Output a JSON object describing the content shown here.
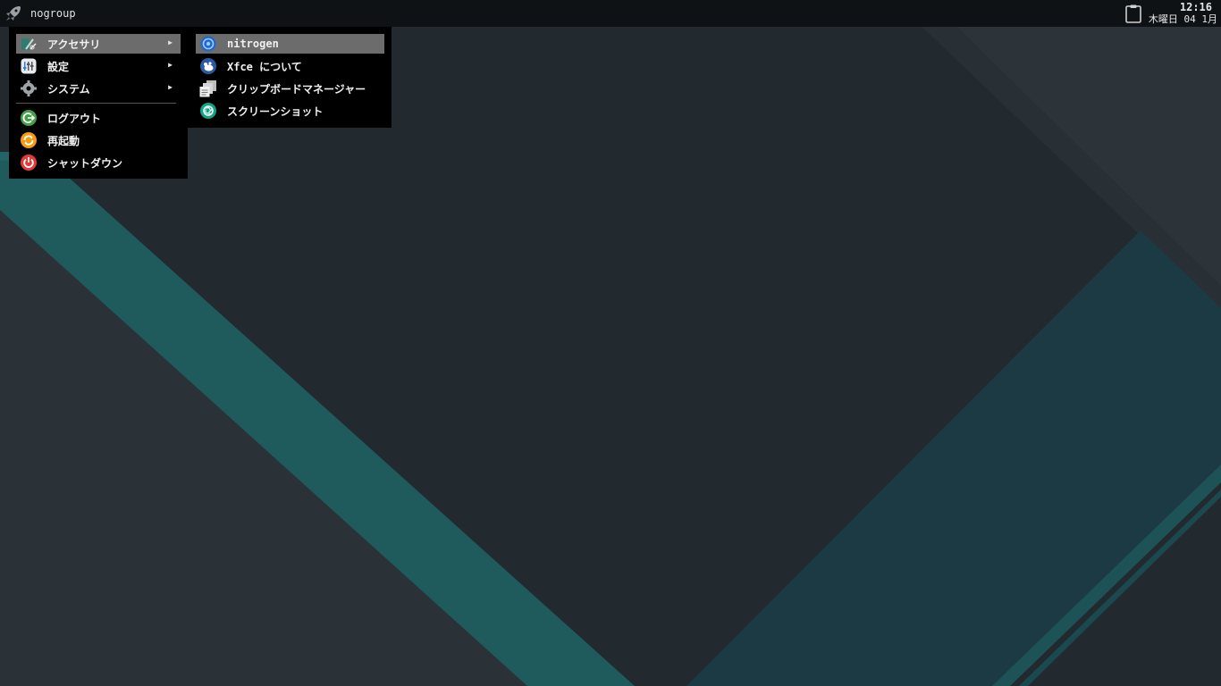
{
  "panel": {
    "launcher_label": "nogroup",
    "clock_time": "12:16",
    "clock_date": "木曜日 04 1月"
  },
  "main_menu": {
    "items": [
      {
        "label": "アクセサリ",
        "icon": "accessories-icon",
        "has_submenu": true,
        "active": true
      },
      {
        "label": "設定",
        "icon": "settings-icon",
        "has_submenu": true
      },
      {
        "label": "システム",
        "icon": "system-gear-icon",
        "has_submenu": true
      },
      {
        "label": "ログアウト",
        "icon": "logout-icon"
      },
      {
        "label": "再起動",
        "icon": "restart-icon"
      },
      {
        "label": "シャットダウン",
        "icon": "shutdown-icon"
      }
    ],
    "submenu_arrow": "▶"
  },
  "sub_menu": {
    "items": [
      {
        "label": "nitrogen",
        "icon": "nitrogen-icon",
        "active": true
      },
      {
        "label": "Xfce について",
        "icon": "xfce-mouse-icon"
      },
      {
        "label": "クリップボードマネージャー",
        "icon": "clipboard-manager-icon"
      },
      {
        "label": "スクリーンショット",
        "icon": "screenshot-icon"
      }
    ]
  },
  "colors": {
    "panel_bg": "#0e1215",
    "menu_bg": "#000000",
    "menu_highlight": "#6c6c6c",
    "wallpaper_dark": "#22292f",
    "wallpaper_teal": "#1f5a5c",
    "wallpaper_blue_teal": "#1b3a44"
  }
}
